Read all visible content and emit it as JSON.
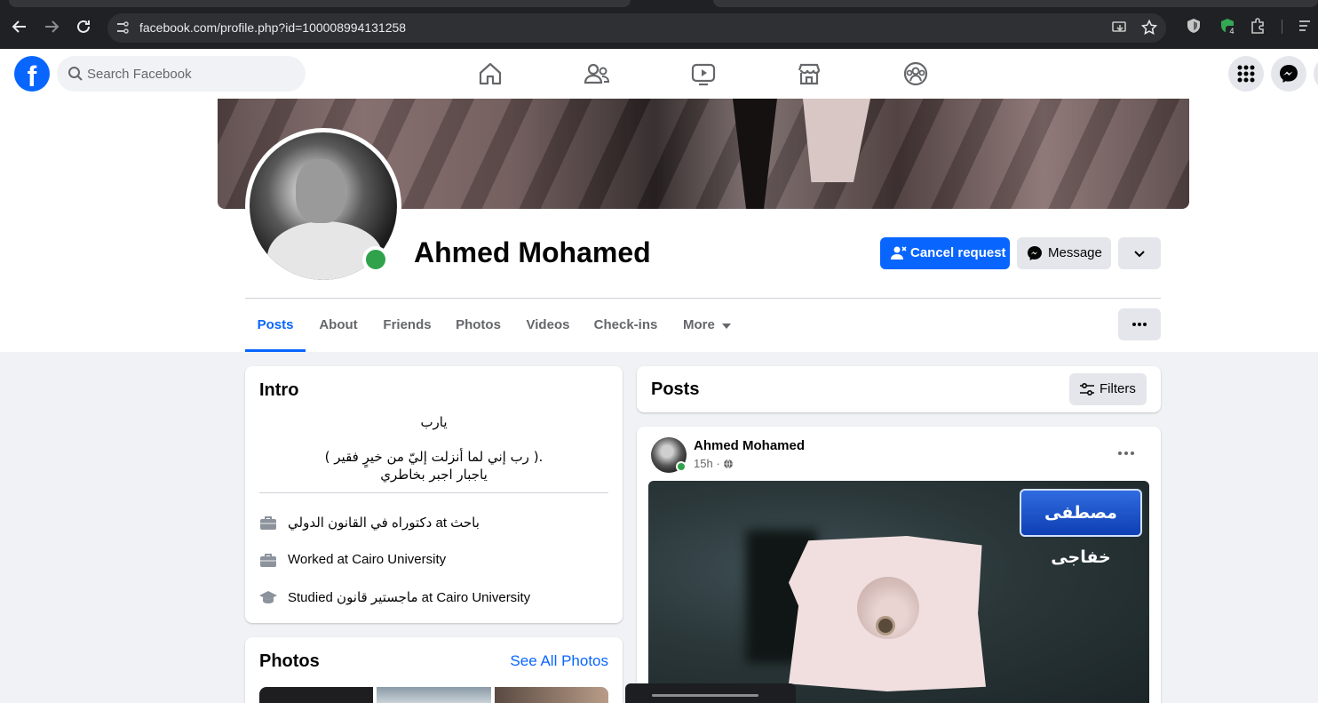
{
  "browser": {
    "url": "facebook.com/profile.php?id=100008994131258",
    "extension_badge": "4"
  },
  "fb_header": {
    "search_placeholder": "Search Facebook",
    "nav": [
      "home-icon",
      "friends-icon",
      "watch-icon",
      "marketplace-icon",
      "groups-icon"
    ]
  },
  "profile": {
    "name": "Ahmed Mohamed",
    "online": true,
    "actions": {
      "cancel_request": "Cancel request",
      "message": "Message"
    },
    "tabs": [
      "Posts",
      "About",
      "Friends",
      "Photos",
      "Videos",
      "Check-ins",
      "More"
    ],
    "active_tab": "Posts"
  },
  "intro": {
    "title": "Intro",
    "bio_lines": [
      "يارب",
      "( رب إني لما أنزلت إليّ من خيرٍ فقير ).",
      "ياجبار اجبر بخاطري"
    ],
    "items": [
      {
        "icon": "briefcase-icon",
        "text": "دكتوراه في القانون الدولي at باحث"
      },
      {
        "icon": "briefcase-icon",
        "text": "Worked at Cairo University"
      },
      {
        "icon": "graduation-cap-icon",
        "text": "Studied ماجستير قانون at Cairo University"
      }
    ]
  },
  "photos": {
    "title": "Photos",
    "see_all": "See All Photos"
  },
  "posts_header": {
    "title": "Posts",
    "filters": "Filters"
  },
  "post": {
    "author": "Ahmed Mohamed",
    "time": "15h",
    "privacy_icon": "globe-icon",
    "image_label": "مصطفى خفاجى"
  },
  "colors": {
    "fb_blue": "#0866ff",
    "online_green": "#31a24c",
    "page_bg": "#f0f2f5"
  }
}
